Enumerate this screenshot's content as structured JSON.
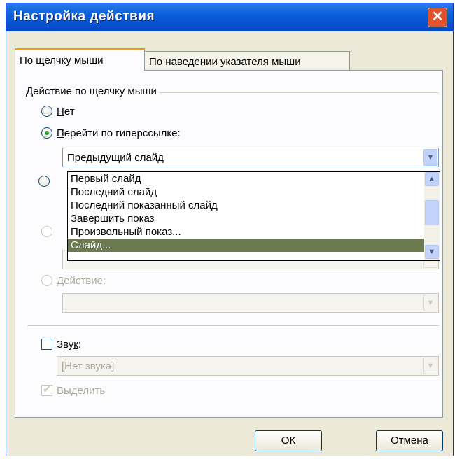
{
  "window": {
    "title": "Настройка действия",
    "close_icon": "close-icon"
  },
  "tabs": [
    {
      "label": "По щелчку мыши",
      "active": true
    },
    {
      "label": "По наведении указателя мыши",
      "active": false
    }
  ],
  "group": {
    "title": "Действие по щелчку мыши"
  },
  "radios": {
    "none": {
      "label": "Нет",
      "checked": false
    },
    "hyperlink": {
      "label": "Перейти по гиперссылке:",
      "checked": true
    },
    "action": {
      "label": "Действие:",
      "disabled": true
    }
  },
  "hyperlink_combo": {
    "value": "Предыдущий слайд"
  },
  "dropdown": {
    "items": [
      "Первый слайд",
      "Последний слайд",
      "Последний показанный слайд",
      "Завершить показ",
      "Произвольный показ...",
      "Слайд..."
    ],
    "selected_index": 5
  },
  "sound": {
    "label": "Звук:",
    "checked": false,
    "value": "[Нет звука]"
  },
  "highlight": {
    "label": "Выделить",
    "checked": true,
    "disabled": true
  },
  "buttons": {
    "ok": "ОК",
    "cancel": "Отмена"
  }
}
